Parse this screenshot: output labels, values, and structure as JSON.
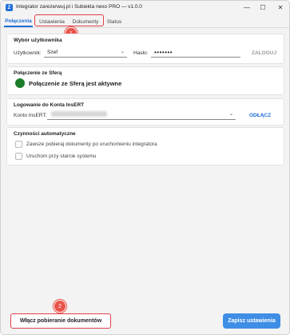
{
  "window": {
    "title": "Integrator zarezerwuj.pl i Subiekta nexo PRO — v1.0.0",
    "app_icon_letter": "Z",
    "minimize_glyph": "—",
    "maximize_glyph": "☐",
    "close_glyph": "✕"
  },
  "tabs": [
    {
      "label": "Połączenia",
      "active": true
    },
    {
      "label": "Ustawienia",
      "active": false
    },
    {
      "label": "Dokumenty",
      "active": false
    },
    {
      "label": "Status",
      "active": false
    }
  ],
  "markers": [
    "1",
    "2"
  ],
  "user_section": {
    "title": "Wybór użytkownika",
    "user_label": "Użytkownik:",
    "user_value": "Szef",
    "password_label": "Hasło:",
    "password_value": "•••••••",
    "login_button": "ZALOGUJ"
  },
  "sfera_section": {
    "title": "Połączenie ze Sferą",
    "status_text": "Połączenie ze Sferą jest aktywne",
    "status_color": "#1b7d2a"
  },
  "konto_section": {
    "title": "Logowanie do Konta InsERT",
    "account_label": "Konto InsERT:",
    "disconnect_button": "ODŁĄCZ"
  },
  "auto_section": {
    "title": "Czynności automatyczne",
    "options": [
      {
        "label": "Zawsze pobieraj dokumenty po uruchomieniu integratora",
        "checked": false
      },
      {
        "label": "Uruchom przy starcie systemu",
        "checked": false
      }
    ]
  },
  "footer": {
    "start_button": "Włącz pobieranie dokumentów",
    "save_button": "Zapisz ustawienia"
  },
  "colors": {
    "accent": "#1e6fd9",
    "highlight": "#e0404a",
    "save_button": "#3f8ee6"
  }
}
